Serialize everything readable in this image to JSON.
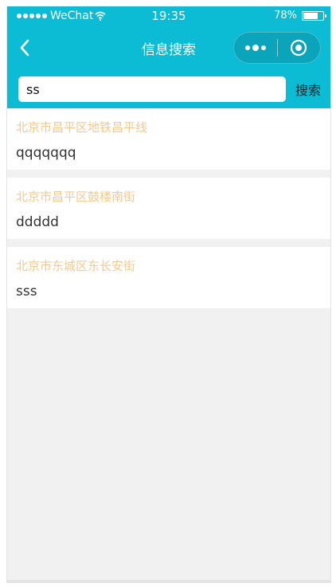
{
  "status_bar": {
    "carrier": "WeChat",
    "time": "19:35",
    "battery": "78%",
    "battery_level": 0.78
  },
  "nav": {
    "title": "信息搜索",
    "back_icon": "chevron-left-icon",
    "more_icon": "more-dots-icon",
    "close_icon": "target-circle-icon"
  },
  "search": {
    "value": "ss",
    "button_label": "搜索"
  },
  "results": [
    {
      "address": "北京市昌平区地铁昌平线",
      "content": "qqqqqqq"
    },
    {
      "address": "北京市昌平区鼓楼南街",
      "content": "ddddd"
    },
    {
      "address": "北京市东城区东长安街",
      "content": "sss"
    }
  ],
  "colors": {
    "header": "#0cbcd4",
    "address": "#f3c98e",
    "background": "#f1f1f1"
  }
}
